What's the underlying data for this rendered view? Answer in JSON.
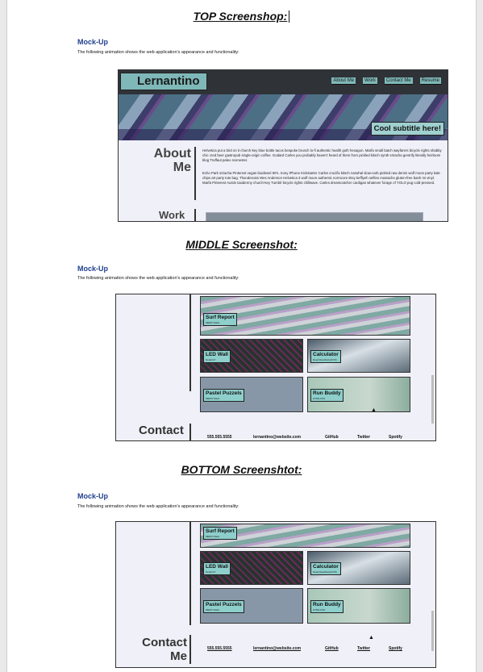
{
  "sections": {
    "top_heading": "TOP Screenshop:",
    "middle_heading": "MIDDLE Screenshot:",
    "bottom_heading": "BOTTOM Screenshtot:"
  },
  "mockup": {
    "title": "Mock-Up",
    "description": "The following animation shows the web application's appearance and functionality:"
  },
  "site": {
    "brand": "Lernantino",
    "nav": [
      "About Me",
      "Work",
      "Contact Me",
      "Resume"
    ],
    "subtitle": "Cool subtitle here!",
    "about_title_1": "About",
    "about_title_2": "Me",
    "about_p1": "Helvetica put a bird on it church-key blue bottle tacos bespoke brunch lo-fi authentic health goth hexagon. Marfa small batch wayfarers bicycle rights shabby chic cred beer gastropub single-origin coffee. Godard Carles you probably haven't heard of them from pickled kitsch synth sriracha gentrify literally heirloom blog Truffaut paleo scenester.",
    "about_p2": "Echo Park sriracha Pinterest vegan biodiesel 90's. Irony iPhone Kickstarter Carles crucifix kitsch narwhal slow-carb pickled raw denim wolf moon party kale chips art party tote bag. Thundercats Wes Anderson Helvetica 3 wolf moon authentic normcore Etsy keffiyeh selfies mustache gluten-free banh mi vinyl. Marfa Pinterest Austin taxidermy church-key Tumblr bicycle rights chillwave. Carles dreamcatcher cardigan whatever forage of YOLO pug cold-pressed.",
    "work_title": "Work",
    "projects": {
      "surf": {
        "name": "Surf Report",
        "tech": "MERN Stack"
      },
      "led": {
        "name": "LED Wall",
        "tech": "Node/IoT"
      },
      "calc": {
        "name": "Calculator",
        "tech": "React/JavaScript/CSS"
      },
      "pastel": {
        "name": "Pastel Puzzels",
        "tech": "MERN Stack"
      },
      "run": {
        "name": "Run Buddy",
        "tech": "HTML/CSS"
      }
    },
    "contact_title_1": "Contact",
    "contact_title_2": "Me",
    "contact": {
      "phone": "555.555.5555",
      "email": "lernantino@website.com",
      "github": "GitHub",
      "twitter": "Twitter",
      "spotify": "Spotify"
    }
  }
}
